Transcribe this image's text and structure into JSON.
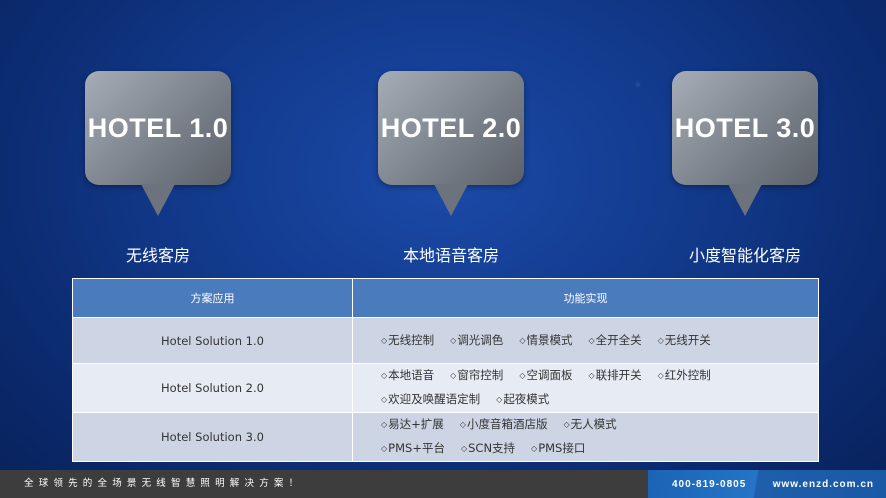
{
  "bubbles": [
    {
      "label": "HOTEL 1.0",
      "caption": "无线客房"
    },
    {
      "label": "HOTEL 2.0",
      "caption": "本地语音客房"
    },
    {
      "label": "HOTEL 3.0",
      "caption": "小度智能化客房"
    }
  ],
  "table": {
    "headers": [
      "方案应用",
      "功能实现"
    ],
    "rows": [
      {
        "name": "Hotel Solution 1.0",
        "lines": [
          [
            "无线控制",
            "调光调色",
            "情景模式",
            "全开全关",
            "无线开关"
          ]
        ]
      },
      {
        "name": "Hotel Solution 2.0",
        "lines": [
          [
            "本地语音",
            "窗帘控制",
            "空调面板",
            "联排开关",
            "红外控制"
          ],
          [
            "欢迎及唤醒语定制",
            "起夜模式"
          ]
        ]
      },
      {
        "name": "Hotel Solution 3.0",
        "lines": [
          [
            "易达+扩展",
            "小度音箱酒店版",
            "无人模式"
          ],
          [
            "PMS+平台",
            "SCN支持",
            "PMS接口"
          ]
        ]
      }
    ]
  },
  "footer": {
    "slogan": "全球领先的全场景无线智慧照明解决方案！",
    "phone": "400-819-0805",
    "website": "www.enzd.com.cn"
  },
  "colors": {
    "background": "#123a8c",
    "table_header": "#4a7bbd",
    "row_dark": "#cdd5e4",
    "row_light": "#e7ebf4",
    "footer_left": "#3d3d3d",
    "footer_right": "#1b63b5"
  }
}
